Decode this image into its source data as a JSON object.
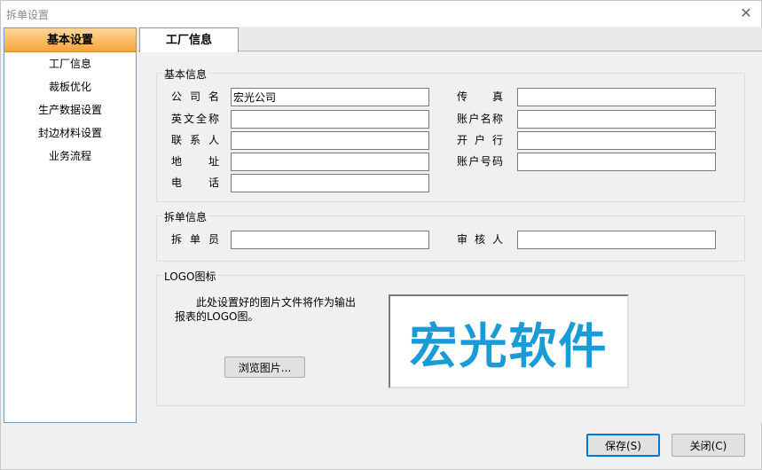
{
  "window": {
    "title": "拆单设置"
  },
  "sidebar": {
    "header": "基本设置",
    "items": [
      {
        "label": "工厂信息"
      },
      {
        "label": "裁板优化"
      },
      {
        "label": "生产数据设置"
      },
      {
        "label": "封边材料设置"
      },
      {
        "label": "业务流程"
      }
    ]
  },
  "tabs": [
    {
      "label": "工厂信息"
    }
  ],
  "basic_info": {
    "title": "基本信息",
    "company_name": {
      "label": "公司名",
      "value": "宏光公司"
    },
    "fax": {
      "label": "传真",
      "value": ""
    },
    "english_name": {
      "label": "英文全称",
      "value": ""
    },
    "account_name": {
      "label": "账户名称",
      "value": ""
    },
    "contact": {
      "label": "联系人",
      "value": ""
    },
    "bank": {
      "label": "开户行",
      "value": ""
    },
    "address": {
      "label": "地址",
      "value": ""
    },
    "account_number": {
      "label": "账户号码",
      "value": ""
    },
    "phone": {
      "label": "电话",
      "value": ""
    }
  },
  "split_info": {
    "title": "拆单信息",
    "splitter": {
      "label": "拆单员",
      "value": ""
    },
    "reviewer": {
      "label": "审核人",
      "value": ""
    }
  },
  "logo": {
    "title": "LOGO图标",
    "description": "此处设置好的图片文件将作为输出报表的LOGO图。",
    "browse_label": "浏览图片...",
    "logo_text": "宏光软件",
    "logo_color": "#1a9ad6"
  },
  "footer": {
    "save_label": "保存(S)",
    "close_label": "关闭(C)"
  }
}
